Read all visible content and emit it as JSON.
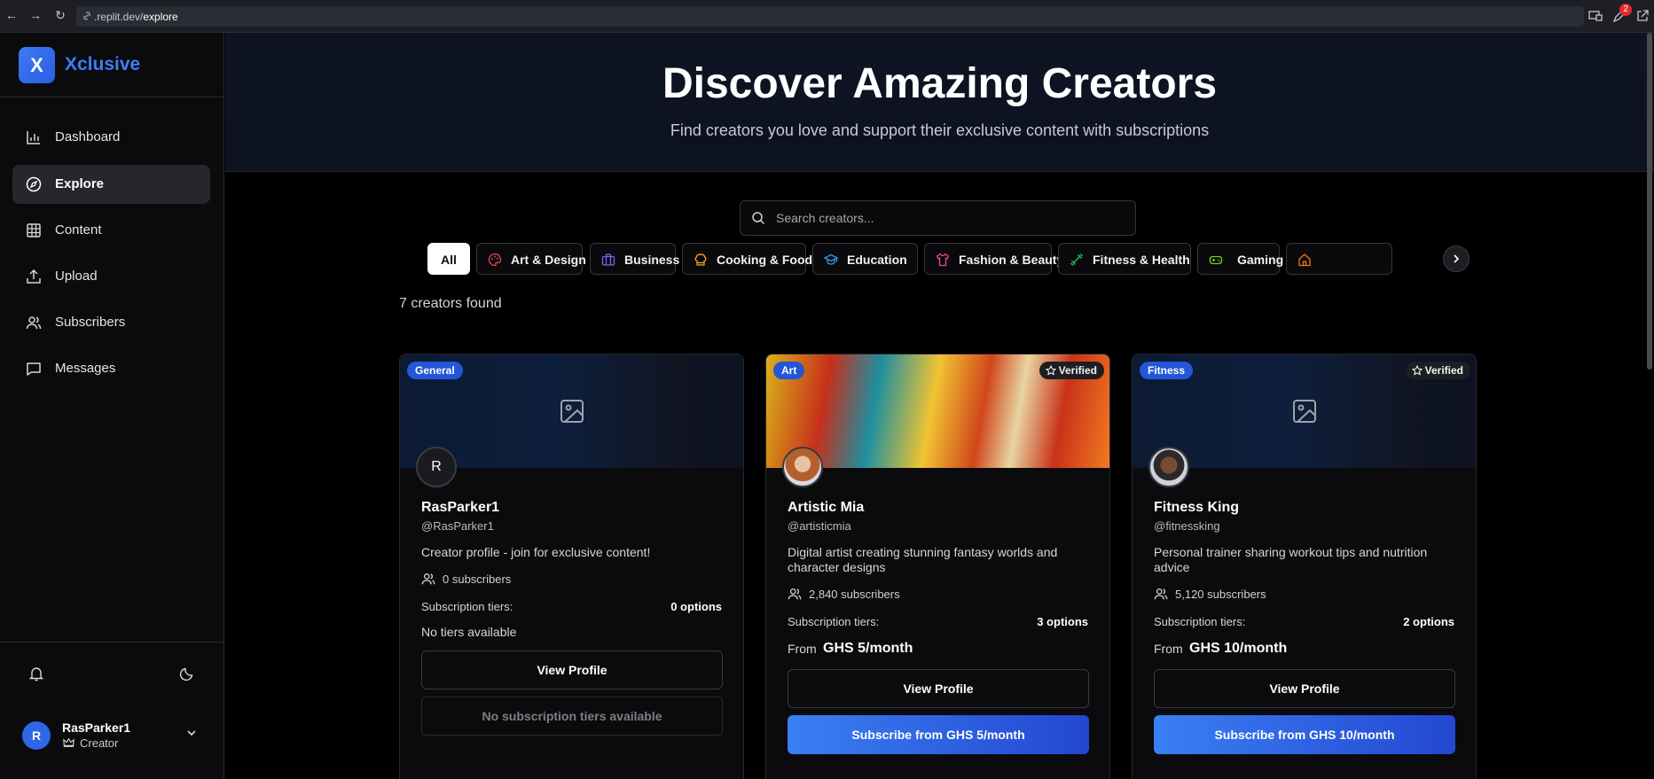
{
  "browser": {
    "url_prefix": ".replit.dev/",
    "url_path": "explore",
    "badge_count": "2"
  },
  "sidebar": {
    "logo_letter": "X",
    "app_name": "Xclusive",
    "items": [
      {
        "label": "Dashboard",
        "icon": "bar-chart-icon"
      },
      {
        "label": "Explore",
        "icon": "compass-icon",
        "active": true
      },
      {
        "label": "Content",
        "icon": "grid-icon"
      },
      {
        "label": "Upload",
        "icon": "upload-icon"
      },
      {
        "label": "Subscribers",
        "icon": "users-icon"
      },
      {
        "label": "Messages",
        "icon": "message-icon"
      }
    ],
    "user": {
      "initial": "R",
      "name": "RasParker1",
      "role": "Creator"
    }
  },
  "hero": {
    "title": "Discover Amazing Creators",
    "subtitle": "Find creators you love and support their exclusive content with subscriptions"
  },
  "search": {
    "placeholder": "Search creators..."
  },
  "categories": [
    {
      "label": "All",
      "active": true
    },
    {
      "label": "Art & Design",
      "icon": "palette-icon",
      "color": "#e5484d"
    },
    {
      "label": "Business",
      "icon": "briefcase-icon",
      "color": "#6f6cf0"
    },
    {
      "label": "Cooking & Food",
      "icon": "chef-hat-icon",
      "color": "#f5a524"
    },
    {
      "label": "Education",
      "icon": "graduation-cap-icon",
      "color": "#2f9ee8"
    },
    {
      "label": "Fashion & Beauty",
      "icon": "shirt-icon",
      "color": "#ec4899"
    },
    {
      "label": "Fitness & Health",
      "icon": "dumbbell-icon",
      "color": "#22c55e"
    },
    {
      "label": "Gaming",
      "icon": "gamepad-icon",
      "color": "#84cc16"
    },
    {
      "label": "",
      "icon": "home-icon",
      "color": "#f97316"
    }
  ],
  "results_count": "7 creators found",
  "creators": [
    {
      "category": "General",
      "verified": "",
      "initial": "R",
      "name": "RasParker1",
      "handle": "@RasParker1",
      "bio": "Creator profile - join for exclusive content!",
      "subscribers": "0 subscribers",
      "tiers_label": "Subscription tiers:",
      "tiers_value": "0 options",
      "no_tiers": "No tiers available",
      "view_label": "View Profile",
      "subscribe_label": "No subscription tiers available"
    },
    {
      "category": "Art",
      "verified": "Verified",
      "initial": "",
      "name": "Artistic Mia",
      "handle": "@artisticmia",
      "bio": "Digital artist creating stunning fantasy worlds and character designs",
      "subscribers": "2,840 subscribers",
      "tiers_label": "Subscription tiers:",
      "tiers_value": "3 options",
      "from_label": "From",
      "price": "GHS 5/month",
      "view_label": "View Profile",
      "subscribe_label": "Subscribe from GHS 5/month"
    },
    {
      "category": "Fitness",
      "verified": "Verified",
      "initial": "",
      "name": "Fitness King",
      "handle": "@fitnessking",
      "bio": "Personal trainer sharing workout tips and nutrition advice",
      "subscribers": "5,120 subscribers",
      "tiers_label": "Subscription tiers:",
      "tiers_value": "2 options",
      "from_label": "From",
      "price": "GHS 10/month",
      "view_label": "View Profile",
      "subscribe_label": "Subscribe from GHS 10/month"
    }
  ]
}
